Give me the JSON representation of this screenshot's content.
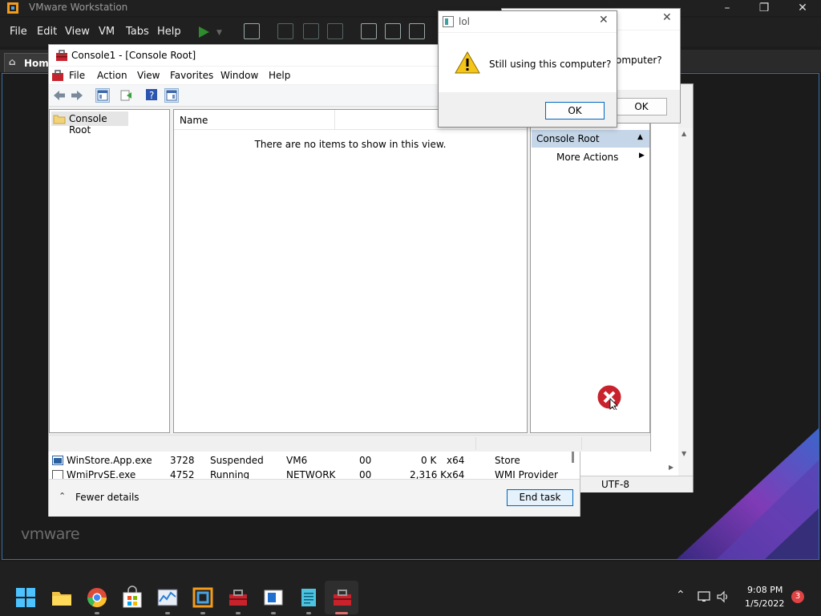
{
  "vmware": {
    "window_title": "VMware Workstation",
    "menus": [
      "File",
      "Edit",
      "View",
      "VM",
      "Tabs",
      "Help"
    ],
    "home_tab": "Home",
    "logo_text": "vmware"
  },
  "mmc": {
    "title": "Console1 - [Console Root]",
    "menus": [
      "File",
      "Action",
      "View",
      "Favorites",
      "Window",
      "Help"
    ],
    "tree_root": "Console Root",
    "column_name": "Name",
    "empty_message": "There are no items to show in this view.",
    "actions_header": "Console Root",
    "more_actions": "More Actions"
  },
  "taskmgr": {
    "rows": [
      {
        "name": "WinStore.App.exe",
        "pid": "3728",
        "status": "Suspended",
        "user": "VM6",
        "cpu": "00",
        "mem": "0 K",
        "arch": "x64",
        "desc": "Store"
      },
      {
        "name": "WmiPrvSE.exe",
        "pid": "4752",
        "status": "Running",
        "user": "NETWORK",
        "cpu": "00",
        "mem": "2,316 K",
        "arch": "x64",
        "desc": "WMI Provider"
      }
    ],
    "fewer_details": "Fewer details",
    "end_task": "End task"
  },
  "notepad": {
    "encoding": "UTF-8"
  },
  "dialog_back": {
    "message_partial": "omputer?",
    "ok": "OK"
  },
  "dialog_lol": {
    "title": "lol",
    "message": "Still using this computer?",
    "ok": "OK"
  },
  "taskbar": {
    "time": "9:08 PM",
    "date": "1/5/2022",
    "notification_count": "3"
  },
  "colors": {
    "vm_chrome": "#202020",
    "accent": "#0067c0",
    "selected_action": "#c5d6e8",
    "notification_badge": "#e04343"
  }
}
